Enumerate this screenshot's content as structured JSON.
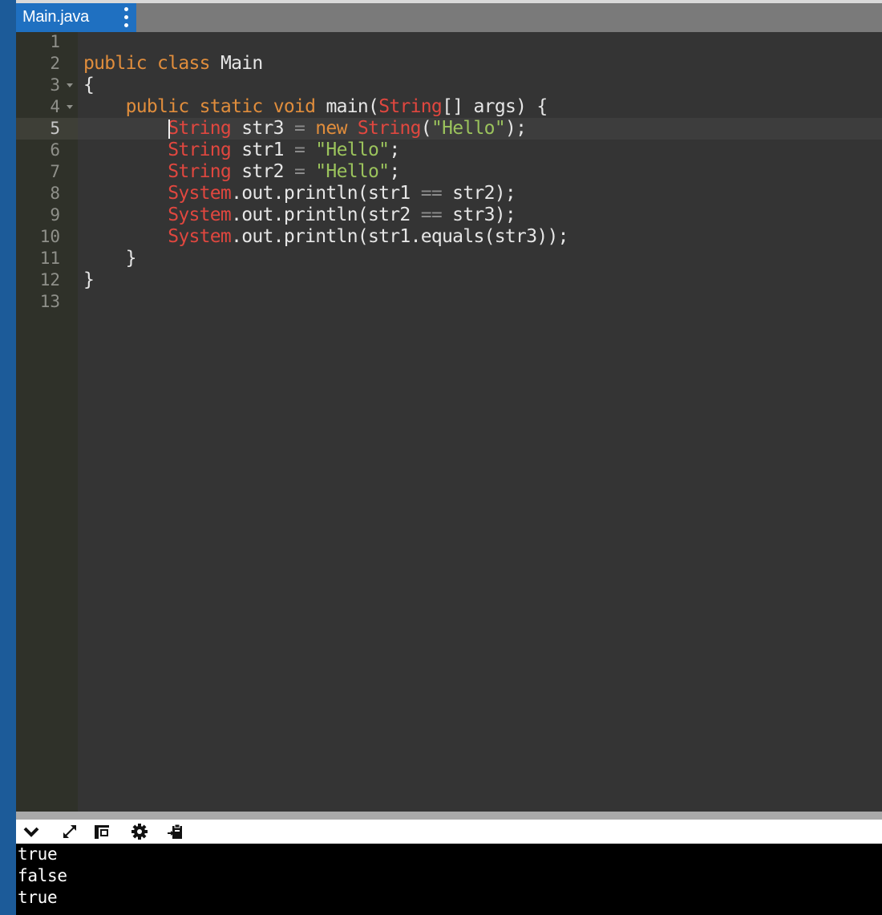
{
  "tab": {
    "filename": "Main.java",
    "menu_icon": "vertical-ellipsis-icon"
  },
  "editor": {
    "line_numbers": [
      "1",
      "2",
      "3",
      "4",
      "5",
      "6",
      "7",
      "8",
      "9",
      "10",
      "11",
      "12",
      "13"
    ],
    "active_line": "5",
    "foldable_lines": [
      "3",
      "4"
    ],
    "tokens": {
      "l2": [
        "public",
        "class",
        "Main"
      ],
      "l3": [
        "{"
      ],
      "l4": [
        "public",
        "static",
        "void",
        "main(",
        "String",
        "[] args) {"
      ],
      "l5": [
        "String",
        " str3 ",
        "=",
        " ",
        "new",
        " ",
        "String",
        "(",
        "\"Hello\"",
        ");"
      ],
      "l6": [
        "String",
        " str1 ",
        "=",
        " ",
        "\"Hello\"",
        ";"
      ],
      "l7": [
        "String",
        " str2 ",
        "=",
        " ",
        "\"Hello\"",
        ";"
      ],
      "l8": [
        "System",
        ".out.println(str1 ",
        "==",
        " str2);"
      ],
      "l9": [
        "System",
        ".out.println(str2 ",
        "==",
        " str3);"
      ],
      "l10": [
        "System",
        ".out.println(str1.equals(str3));"
      ],
      "l11": [
        "}"
      ],
      "l12": [
        "}"
      ]
    }
  },
  "console": {
    "toolbar_icons": [
      "chevron-down-icon",
      "expand-icon",
      "layout-icon",
      "gear-icon",
      "clipboard-icon"
    ],
    "output": [
      "true",
      "false",
      "true"
    ]
  },
  "colors": {
    "keyword": "#e08d3c",
    "type": "#e0473f",
    "string": "#9bc35c",
    "plain": "#e6e6e6",
    "editor_bg": "#343434",
    "tab_bg": "#1f70c1"
  }
}
